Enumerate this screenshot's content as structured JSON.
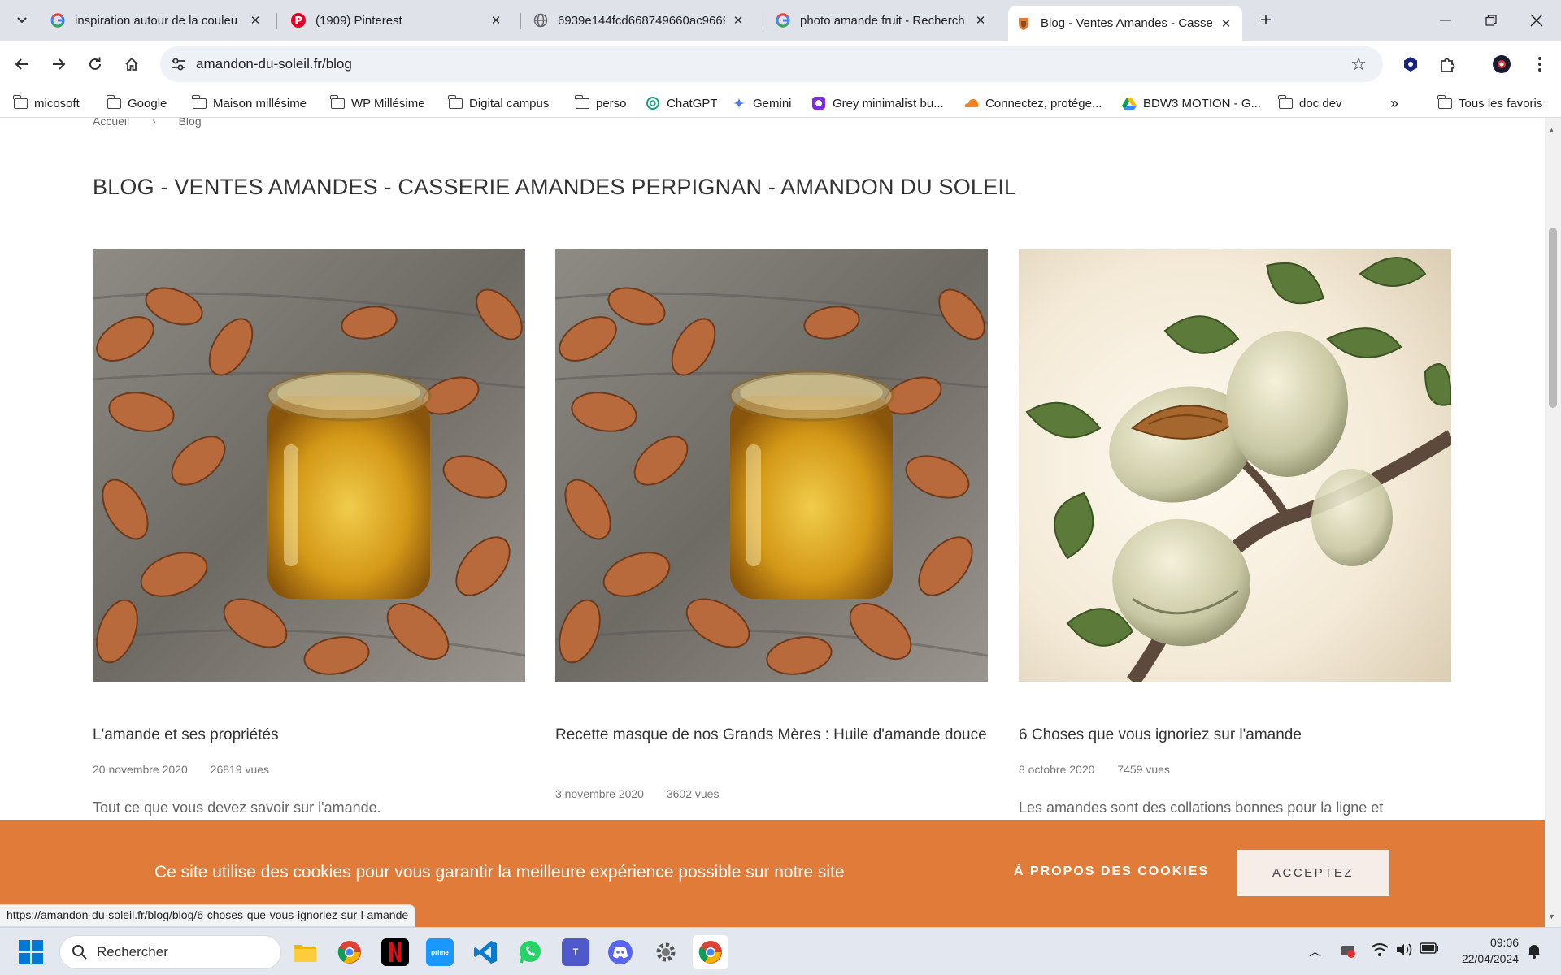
{
  "browser": {
    "tabs": [
      {
        "title": "inspiration autour de la couleu",
        "favicon": "google-icon"
      },
      {
        "title": "(1909) Pinterest",
        "favicon": "pinterest-icon"
      },
      {
        "title": "6939e144fcd668749660ac9669",
        "favicon": "globe-icon"
      },
      {
        "title": "photo amande fruit - Recherch",
        "favicon": "google-icon"
      },
      {
        "title": "Blog - Ventes Amandes - Casse",
        "favicon": "site-icon",
        "active": true
      }
    ],
    "url": "amandon-du-soleil.fr/blog",
    "bookmarks": [
      {
        "label": "micosoft",
        "icon": "folder-icon"
      },
      {
        "label": "Google",
        "icon": "folder-icon"
      },
      {
        "label": "Maison millésime",
        "icon": "folder-icon"
      },
      {
        "label": "WP Millésime",
        "icon": "folder-icon"
      },
      {
        "label": "Digital campus",
        "icon": "folder-icon"
      },
      {
        "label": "perso",
        "icon": "folder-icon"
      },
      {
        "label": "ChatGPT",
        "icon": "chatgpt-icon"
      },
      {
        "label": "Gemini",
        "icon": "gemini-icon"
      },
      {
        "label": "Grey minimalist bu...",
        "icon": "canva-icon"
      },
      {
        "label": "Connectez, protége...",
        "icon": "cloudflare-icon"
      },
      {
        "label": "BDW3 MOTION - G...",
        "icon": "drive-icon"
      },
      {
        "label": "doc dev",
        "icon": "folder-icon"
      }
    ],
    "all_bookmarks": "Tous les favoris"
  },
  "page": {
    "breadcrumb": [
      "Accueil",
      "Blog"
    ],
    "title": "BLOG - VENTES AMANDES - CASSERIE AMANDES PERPIGNAN - AMANDON DU SOLEIL",
    "posts": [
      {
        "title": "L'amande et ses propriétés",
        "date": "20 novembre 2020",
        "views": "26819 vues",
        "excerpt": "Tout ce que vous devez savoir sur l'amande."
      },
      {
        "title": "Recette masque de nos Grands Mères : Huile d'amande douce",
        "date": "3 novembre 2020",
        "views": "3602 vues",
        "excerpt": ""
      },
      {
        "title": "6 Choses que vous ignoriez sur l'amande",
        "date": "8 octobre 2020",
        "views": "7459 vues",
        "excerpt": "Les amandes sont des collations bonnes pour la ligne et"
      }
    ]
  },
  "cookie": {
    "message": "Ce site utilise des cookies pour vous garantir la meilleure expérience possible sur notre site",
    "about": "À PROPOS DES COOKIES",
    "accept": "ACCEPTEZ"
  },
  "status_url": "https://amandon-du-soleil.fr/blog/blog/6-choses-que-vous-ignoriez-sur-l-amande",
  "taskbar": {
    "search": "Rechercher",
    "time": "09:06",
    "date": "22/04/2024"
  },
  "colors": {
    "cookie_banner": "#e07b39",
    "accept_button": "#f6ece8"
  }
}
